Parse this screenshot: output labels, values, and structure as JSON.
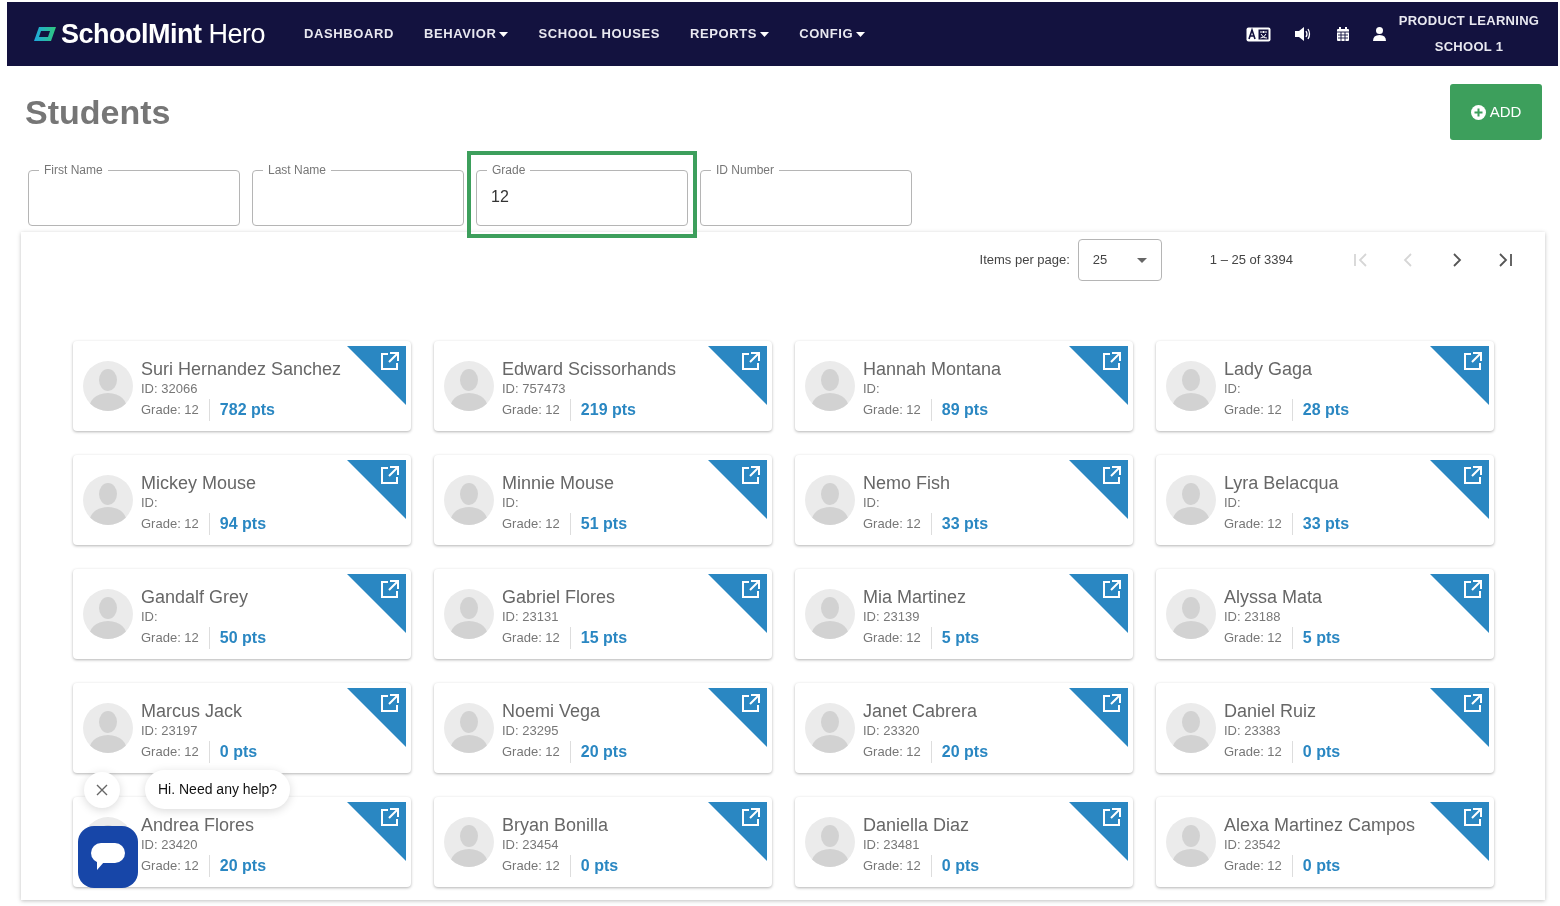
{
  "navbar": {
    "brand": "**SchoolMint** Hero",
    "items": [
      {
        "label": "DASHBOARD",
        "dropdown": false
      },
      {
        "label": "BEHAVIOR",
        "dropdown": true
      },
      {
        "label": "SCHOOL HOUSES",
        "dropdown": false
      },
      {
        "label": "REPORTS",
        "dropdown": true
      },
      {
        "label": "CONFIG",
        "dropdown": true
      }
    ],
    "school": "PRODUCT LEARNING SCHOOL 1"
  },
  "page": {
    "title": "Students",
    "add_button": "ADD"
  },
  "filters": [
    {
      "label": "First Name",
      "highlighted": false
    },
    {
      "label": "Last Name",
      "highlighted": false
    },
    {
      "label": "Grade",
      "value": "12",
      "highlighted": true
    },
    {
      "label": "ID Number",
      "highlighted": false
    }
  ],
  "pagination": {
    "items_label": "Items per page:",
    "page_size": "25",
    "range": "1 – 25 of 3394",
    "buttons": [
      {
        "kind": "first",
        "disabled": true
      },
      {
        "kind": "prev",
        "disabled": true
      },
      {
        "kind": "next",
        "disabled": false
      },
      {
        "kind": "last",
        "disabled": false
      }
    ]
  },
  "students": [
    {
      "name": "Suri Hernandez Sanchez",
      "id": "ID: 32066",
      "grade": "Grade: 12",
      "points": "782 pts"
    },
    {
      "name": "Edward Scissorhands",
      "id": "ID: 757473",
      "grade": "Grade: 12",
      "points": "219 pts"
    },
    {
      "name": "Hannah Montana",
      "id": "ID:",
      "grade": "Grade: 12",
      "points": "89 pts"
    },
    {
      "name": "Lady Gaga",
      "id": "ID:",
      "grade": "Grade: 12",
      "points": "28 pts"
    },
    {
      "name": "Mickey Mouse",
      "id": "ID:",
      "grade": "Grade: 12",
      "points": "94 pts"
    },
    {
      "name": "Minnie Mouse",
      "id": "ID:",
      "grade": "Grade: 12",
      "points": "51 pts"
    },
    {
      "name": "Nemo Fish",
      "id": "ID:",
      "grade": "Grade: 12",
      "points": "33 pts"
    },
    {
      "name": "Lyra Belacqua",
      "id": "ID:",
      "grade": "Grade: 12",
      "points": "33 pts"
    },
    {
      "name": "Gandalf Grey",
      "id": "ID:",
      "grade": "Grade: 12",
      "points": "50 pts"
    },
    {
      "name": "Gabriel Flores",
      "id": "ID: 23131",
      "grade": "Grade: 12",
      "points": "15 pts"
    },
    {
      "name": "Mia Martinez",
      "id": "ID: 23139",
      "grade": "Grade: 12",
      "points": "5 pts"
    },
    {
      "name": "Alyssa Mata",
      "id": "ID: 23188",
      "grade": "Grade: 12",
      "points": "5 pts"
    },
    {
      "name": "Marcus Jack",
      "id": "ID: 23197",
      "grade": "Grade: 12",
      "points": "0 pts"
    },
    {
      "name": "Noemi Vega",
      "id": "ID: 23295",
      "grade": "Grade: 12",
      "points": "20 pts"
    },
    {
      "name": "Janet Cabrera",
      "id": "ID: 23320",
      "grade": "Grade: 12",
      "points": "20 pts"
    },
    {
      "name": "Daniel Ruiz",
      "id": "ID: 23383",
      "grade": "Grade: 12",
      "points": "0 pts"
    },
    {
      "name": "Andrea Flores",
      "id": "ID: 23420",
      "grade": "Grade: 12",
      "points": "20 pts"
    },
    {
      "name": "Bryan Bonilla",
      "id": "ID: 23454",
      "grade": "Grade: 12",
      "points": "0 pts"
    },
    {
      "name": "Daniella Diaz",
      "id": "ID: 23481",
      "grade": "Grade: 12",
      "points": "0 pts"
    },
    {
      "name": "Alexa Martinez Campos",
      "id": "ID: 23542",
      "grade": "Grade: 12",
      "points": "0 pts"
    }
  ],
  "chat": {
    "greeting": "Hi. Need any help?"
  }
}
